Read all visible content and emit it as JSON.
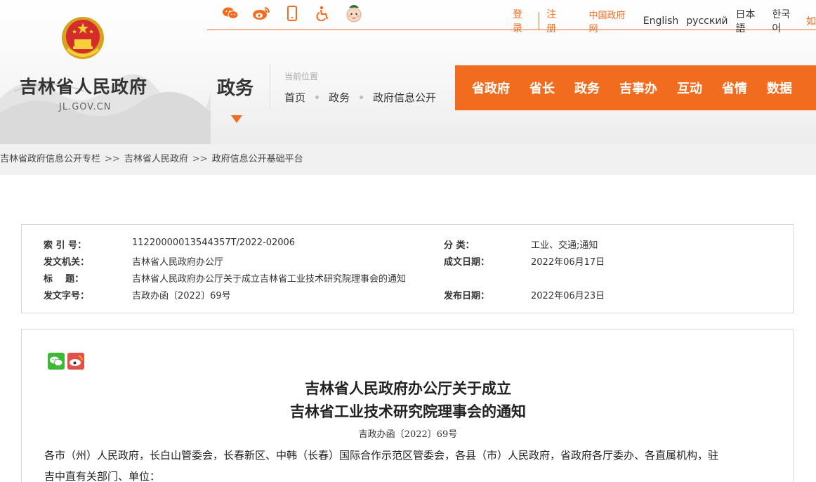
{
  "header": {
    "site_name": "吉林省人民政府",
    "site_domain": "JL.GOV.CN",
    "section_title": "政务",
    "location_label": "当前位置",
    "location_crumbs": [
      "首页",
      "政务",
      "政府信息公开"
    ]
  },
  "topbar": {
    "icons": [
      "wechat-icon",
      "weibo-icon",
      "mobile-icon",
      "accessibility-icon",
      "mascot-icon"
    ],
    "login": "登录",
    "register": "注册",
    "cn_gov": "中国政府网",
    "languages": [
      "English",
      "русский",
      "日本語",
      "한국어"
    ],
    "cut_text": "如"
  },
  "nav": {
    "items": [
      "省政府",
      "省长",
      "政务",
      "吉事办",
      "互动",
      "省情",
      "数据"
    ]
  },
  "breadcrumb": {
    "items": [
      "吉林省政府信息公开专栏",
      "吉林省人民政府",
      "政府信息公开基础平台"
    ],
    "separator": ">>"
  },
  "meta": {
    "index_label": "索 引 号：",
    "index_value": "11220000013544357T/2022-02006",
    "category_label": "分    类：",
    "category_value": "工业、交通;通知",
    "issuer_label": "发文机关：",
    "issuer_value": "吉林省人民政府办公厅",
    "written_label": "成文日期：",
    "written_value": "2022年06月17日",
    "title_label": "标    题：",
    "title_value": "吉林省人民政府办公厅关于成立吉林省工业技术研究院理事会的通知",
    "docno_label": "发文字号：",
    "docno_value": "吉政办函〔2022〕69号",
    "published_label": "发布日期：",
    "published_value": "2022年06月23日"
  },
  "document": {
    "title_line1": "吉林省人民政府办公厅关于成立",
    "title_line2": "吉林省工业技术研究院理事会的通知",
    "doc_number": "吉政办函〔2022〕69号",
    "body_line1": "各市（州）人民政府，长白山管委会，长春新区、中韩（长春）国际合作示范区管委会，各县（市）人民政府，省政府各厅委办、各直属机构，驻",
    "body_line2": "吉中直有关部门、单位："
  },
  "colors": {
    "accent": "#f26c1f",
    "wechat": "#3fb838",
    "weibo": "#e0524a"
  }
}
